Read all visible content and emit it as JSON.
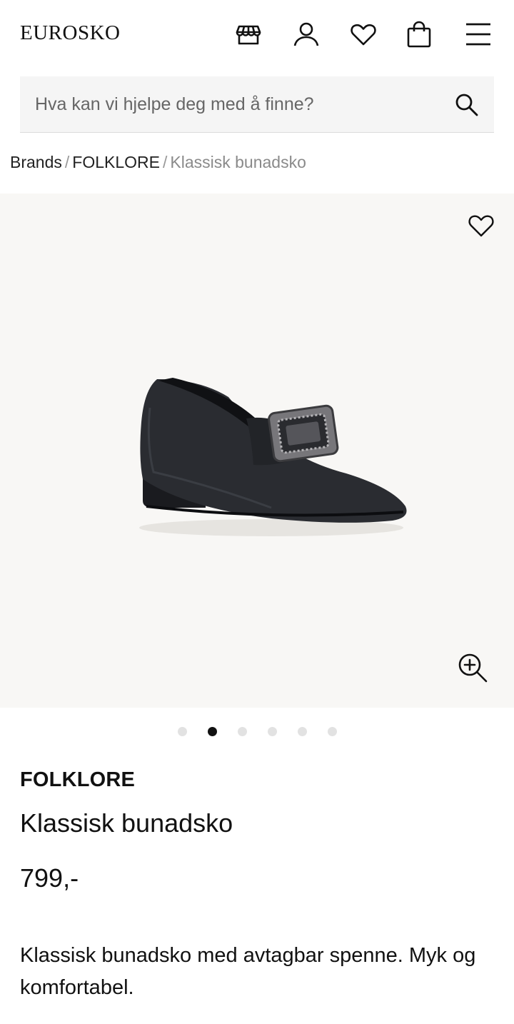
{
  "header": {
    "logo": "EUROSKO",
    "icons": [
      "store-icon",
      "account-icon",
      "wishlist-icon",
      "cart-icon",
      "menu-icon"
    ]
  },
  "search": {
    "placeholder": "Hva kan vi hjelpe deg med å finne?"
  },
  "breadcrumb": {
    "items": [
      "Brands",
      "FOLKLORE",
      "Klassisk bunadsko"
    ],
    "separator": "/"
  },
  "gallery": {
    "image_label": "black leather bunad shoe with silver buckle",
    "total_images": 6,
    "active_index": 1
  },
  "product": {
    "brand": "FOLKLORE",
    "name": "Klassisk bunadsko",
    "price": "799,-",
    "description": "Klassisk bunadsko med avtagbar spenne. Myk og komfortabel."
  },
  "colors": {
    "text": "#111111",
    "muted": "#8a8a8a",
    "search_bg": "#f5f5f5",
    "gallery_bg": "#f8f7f5",
    "dot_inactive": "#e2e2e2",
    "dot_active": "#111111"
  }
}
